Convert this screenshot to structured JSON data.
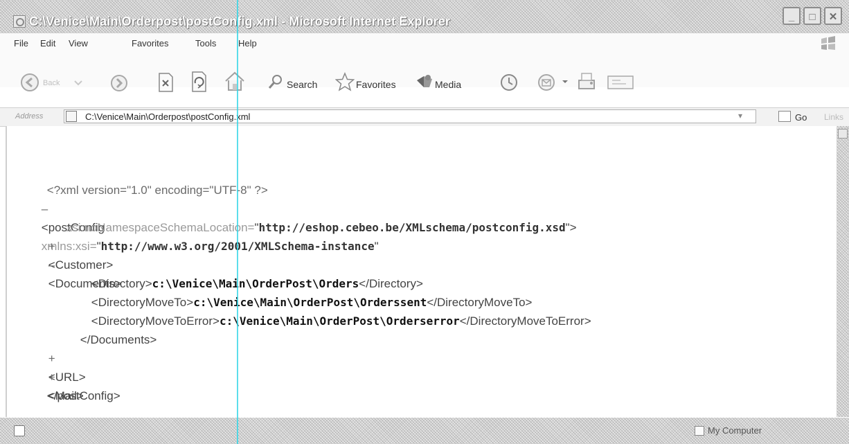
{
  "window": {
    "title": "C:\\Venice\\Main\\Orderpost\\postConfig.xml - Microsoft Internet Explorer",
    "caption_buttons": [
      "_",
      "□",
      "✕"
    ]
  },
  "menu": [
    "File",
    "Edit",
    "View",
    "Favorites",
    "Tools",
    "Help"
  ],
  "toolbar": {
    "back": "Back",
    "search": "Search",
    "favorites": "Favorites",
    "media": "Media"
  },
  "address": {
    "label": "Address",
    "value": "C:\\Venice\\Main\\Orderpost\\postConfig.xml",
    "go": "Go",
    "links": "Links"
  },
  "xml": {
    "decl": "<?xml version=\"1.0\" encoding=\"UTF-8\" ?>",
    "root_open_marker": "–",
    "root_tag": "<postConfig",
    "attr1_name": "xmlns:xsi=",
    "attr1_value": "http://www.w3.org/2001/XMLSchema-instance",
    "attr2_name": "xsi:noNamespaceSchemaLocation=",
    "attr2_value": "http://eshop.cebeo.be/XMLschema/postconfig.xsd",
    "customer_marker": "+",
    "customer": "<Customer>",
    "documents_marker": "–",
    "documents_open": "<Documents>",
    "dir_open": "<Directory>",
    "dir_value": "c:\\Venice\\Main\\OrderPost\\Orders",
    "dir_close": "</Directory>",
    "dirmove_open": "<DirectoryMoveTo>",
    "dirmove_value": "c:\\Venice\\Main\\OrderPost\\Orderssent",
    "dirmove_close": "</DirectoryMoveTo>",
    "direrr_open": "<DirectoryMoveToError>",
    "direrr_value": "c:\\Venice\\Main\\OrderPost\\Orderserror",
    "direrr_close": "</DirectoryMoveToError>",
    "documents_close": "</Documents>",
    "url_marker": "+",
    "url": "<URL>",
    "mail_marker": "+",
    "mail": "<Mail>",
    "root_close": "</postConfig>"
  },
  "status": {
    "zone": "My Computer"
  }
}
